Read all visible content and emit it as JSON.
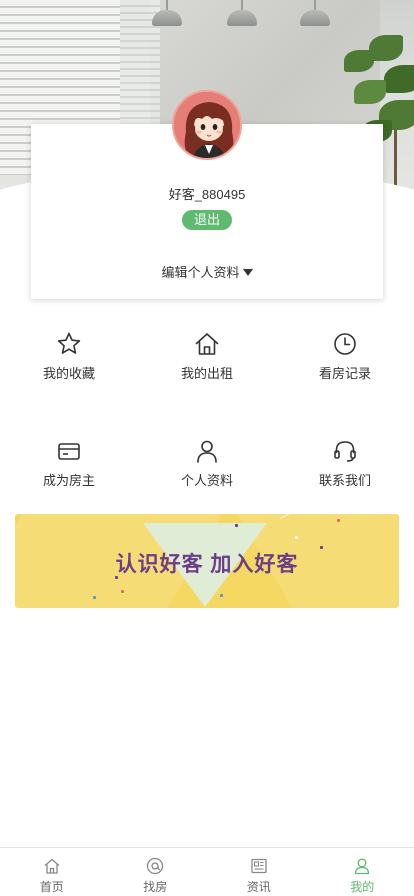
{
  "profile": {
    "username": "好客_880495",
    "logout_label": "退出",
    "edit_label": "编辑个人资料"
  },
  "menu": [
    {
      "label": "我的收藏",
      "icon": "star-icon"
    },
    {
      "label": "我的出租",
      "icon": "house-icon"
    },
    {
      "label": "看房记录",
      "icon": "clock-icon"
    },
    {
      "label": "成为房主",
      "icon": "card-icon"
    },
    {
      "label": "个人资料",
      "icon": "person-icon"
    },
    {
      "label": "联系我们",
      "icon": "headset-icon"
    }
  ],
  "banner": {
    "text": "认识好客 加入好客"
  },
  "tabbar": {
    "items": [
      {
        "label": "首页",
        "icon": "home-icon"
      },
      {
        "label": "找房",
        "icon": "search-at-icon"
      },
      {
        "label": "资讯",
        "icon": "news-icon"
      },
      {
        "label": "我的",
        "icon": "profile-icon"
      }
    ],
    "active_index": 3
  },
  "colors": {
    "accent": "#5dba6e",
    "banner_bg": "#f5d862",
    "banner_text": "#6b3d8a",
    "avatar_bg": "#e47e76"
  }
}
